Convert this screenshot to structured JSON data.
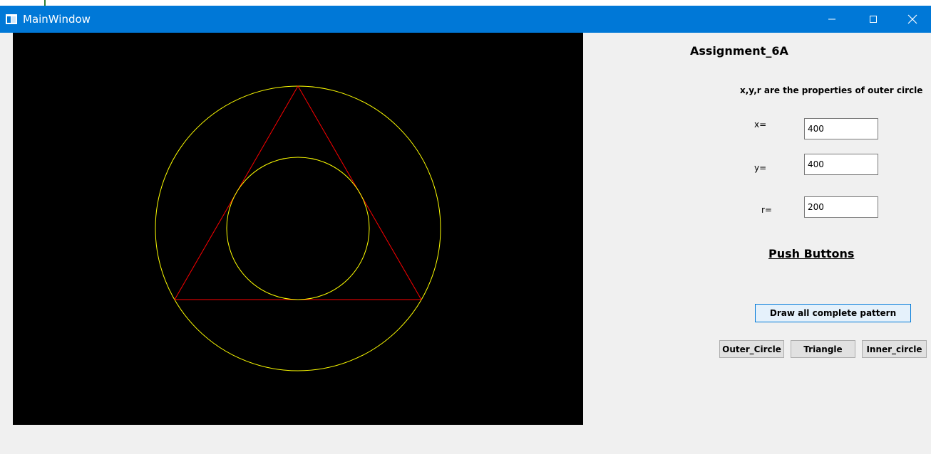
{
  "window": {
    "title": "MainWindow",
    "titlebar_color": "#0078d7",
    "icons": {
      "app": "window-app-icon",
      "minimize": "minimize-icon",
      "maximize": "maximize-icon",
      "close": "close-icon"
    }
  },
  "canvas": {
    "background": "#000000",
    "outer_circle_color": "#ffff00",
    "triangle_color": "#ff0000",
    "inner_circle_color": "#ffff00"
  },
  "panel": {
    "heading": "Assignment_6A",
    "description": "x,y,r are the properties of outer circle",
    "x_label": "x=",
    "x_value": "400",
    "y_label": "y=",
    "y_value": "400",
    "r_label": "r=",
    "r_value": "200",
    "push_heading": "Push Buttons"
  },
  "buttons": {
    "draw_all": "Draw all complete pattern",
    "outer_circle": "Outer_Circle",
    "triangle": "Triangle",
    "inner_circle": "Inner_circle"
  }
}
